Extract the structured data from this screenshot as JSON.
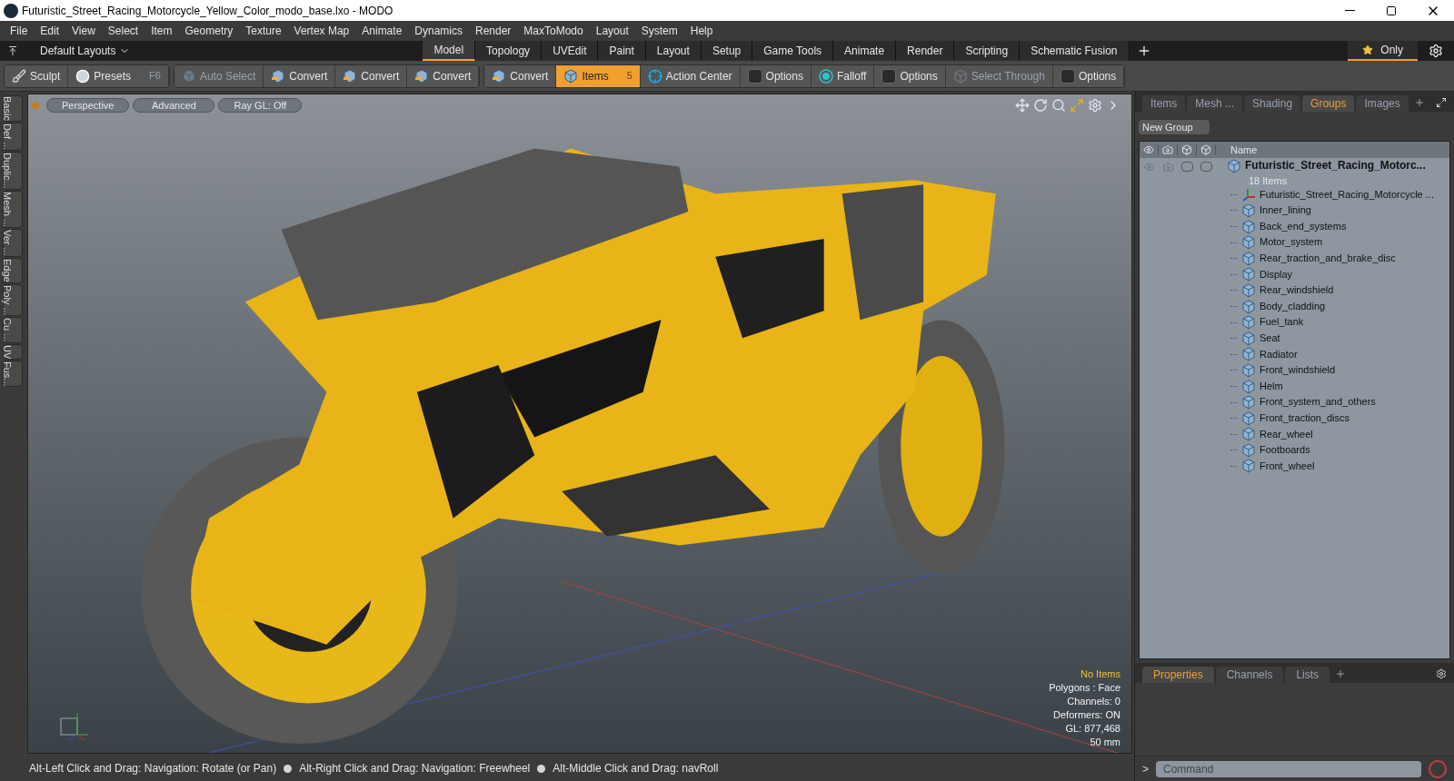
{
  "window": {
    "title": "Futuristic_Street_Racing_Motorcycle_Yellow_Color_modo_base.lxo - MODO"
  },
  "menu": [
    "File",
    "Edit",
    "View",
    "Select",
    "Item",
    "Geometry",
    "Texture",
    "Vertex Map",
    "Animate",
    "Dynamics",
    "Render",
    "MaxToModo",
    "Layout",
    "System",
    "Help"
  ],
  "layout_bar": {
    "preset": "Default Layouts",
    "tabs": [
      {
        "label": "Model",
        "selected": true
      },
      {
        "label": "Topology",
        "selected": false
      },
      {
        "label": "UVEdit",
        "selected": false
      },
      {
        "label": "Paint",
        "selected": false
      },
      {
        "label": "Layout",
        "selected": false
      },
      {
        "label": "Setup",
        "selected": false
      },
      {
        "label": "Game Tools",
        "selected": false
      },
      {
        "label": "Animate",
        "selected": false
      },
      {
        "label": "Render",
        "selected": false
      },
      {
        "label": "Scripting",
        "selected": false
      },
      {
        "label": "Schematic Fusion",
        "selected": false
      }
    ],
    "only": "Only"
  },
  "toolbar": [
    {
      "items": [
        {
          "label": "Sculpt",
          "kind": "sculpt",
          "disabled": false,
          "selected": false
        },
        {
          "label": "Presets",
          "shortcut": "F6",
          "kind": "presets",
          "disabled": false,
          "selected": false
        }
      ]
    },
    {
      "items": [
        {
          "label": "Auto Select",
          "kind": "cube",
          "disabled": true,
          "selected": false
        },
        {
          "label": "Convert",
          "kind": "convert",
          "disabled": false,
          "selected": false
        },
        {
          "label": "Convert",
          "kind": "convert",
          "disabled": false,
          "selected": false
        },
        {
          "label": "Convert",
          "kind": "convert",
          "disabled": false,
          "selected": false
        }
      ]
    },
    {
      "items": [
        {
          "label": "Convert",
          "kind": "convert",
          "disabled": false,
          "selected": false
        },
        {
          "label": "Items",
          "shortcut": "5",
          "kind": "cube",
          "disabled": false,
          "selected": true
        },
        {
          "label": "Action Center",
          "kind": "target",
          "disabled": false,
          "selected": false
        },
        {
          "label": "Options",
          "kind": "options",
          "disabled": false,
          "selected": false
        },
        {
          "label": "Falloff",
          "kind": "falloff",
          "disabled": false,
          "selected": false
        },
        {
          "label": "Options",
          "kind": "options",
          "disabled": false,
          "selected": false
        },
        {
          "label": "Select Through",
          "kind": "through",
          "disabled": true,
          "selected": false
        },
        {
          "label": "Options",
          "kind": "options",
          "disabled": false,
          "selected": false
        }
      ]
    }
  ],
  "side_tabs": [
    "Basic",
    "Def ...",
    "Duplic...",
    "Mesh ...",
    "Ver ...",
    "Edge",
    "Poly ...",
    "Cu ...",
    "UV",
    "Fus..."
  ],
  "viewport": {
    "buttons": [
      "Perspective",
      "Advanced",
      "Ray GL: Off"
    ],
    "info": [
      {
        "text": "No Items",
        "kind": "highlight"
      },
      {
        "text": "Polygons : Face",
        "kind": "plain"
      },
      {
        "text": "Channels: 0",
        "kind": "plain"
      },
      {
        "text": "Deformers: ON",
        "kind": "plain"
      },
      {
        "text": "GL: 877,468",
        "kind": "plain"
      },
      {
        "text": "50 mm",
        "kind": "plain"
      }
    ]
  },
  "status_bar": [
    "Alt-Left Click and Drag: Navigation: Rotate (or Pan)",
    "Alt-Right Click and Drag: Navigation: Freewheel",
    "Alt-Middle Click and Drag: navRoll"
  ],
  "panel": {
    "tabs": [
      {
        "label": "Items",
        "selected": false
      },
      {
        "label": "Mesh ...",
        "selected": false
      },
      {
        "label": "Shading",
        "selected": false
      },
      {
        "label": "Groups",
        "selected": true
      },
      {
        "label": "Images",
        "selected": false
      }
    ],
    "new_group": "New Group",
    "column": "Name",
    "tree": {
      "name": "Futuristic_Street_Racing_Motorc...",
      "count": "18 Items",
      "children": [
        {
          "name": "Futuristic_Street_Racing_Motorcycle ...",
          "kind": "locator"
        },
        {
          "name": "Inner_lining",
          "kind": "mesh"
        },
        {
          "name": "Back_end_systems",
          "kind": "mesh"
        },
        {
          "name": "Motor_system",
          "kind": "mesh"
        },
        {
          "name": "Rear_traction_and_brake_disc",
          "kind": "mesh"
        },
        {
          "name": "Display",
          "kind": "mesh"
        },
        {
          "name": "Rear_windshield",
          "kind": "mesh"
        },
        {
          "name": "Body_cladding",
          "kind": "mesh"
        },
        {
          "name": "Fuel_tank",
          "kind": "mesh"
        },
        {
          "name": "Seat",
          "kind": "mesh"
        },
        {
          "name": "Radiator",
          "kind": "mesh"
        },
        {
          "name": "Front_windshield",
          "kind": "mesh"
        },
        {
          "name": "Helm",
          "kind": "mesh"
        },
        {
          "name": "Front_system_and_others",
          "kind": "mesh"
        },
        {
          "name": "Front_traction_discs",
          "kind": "mesh"
        },
        {
          "name": "Rear_wheel",
          "kind": "mesh"
        },
        {
          "name": "Footboards",
          "kind": "mesh"
        },
        {
          "name": "Front_wheel",
          "kind": "mesh"
        }
      ]
    }
  },
  "bottom_panel": {
    "tabs": [
      {
        "label": "Properties",
        "selected": true
      },
      {
        "label": "Channels",
        "selected": false
      },
      {
        "label": "Lists",
        "selected": false
      }
    ]
  },
  "command": {
    "prompt": ">",
    "placeholder": "Command"
  }
}
